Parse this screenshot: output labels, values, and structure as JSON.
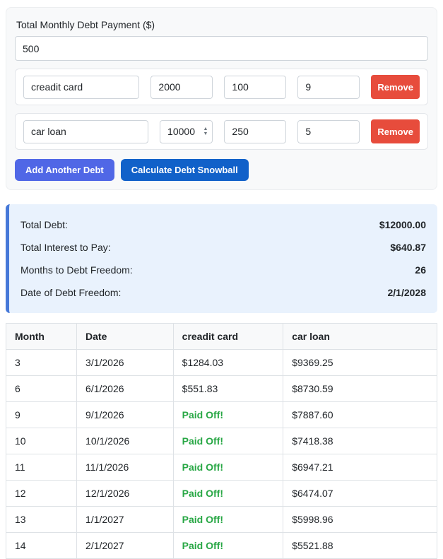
{
  "form": {
    "monthly_payment_label": "Total Monthly Debt Payment ($)",
    "monthly_payment_value": "500",
    "remove_label": "Remove",
    "debts": [
      {
        "name": "creadit card",
        "balance": "2000",
        "min_payment": "100",
        "rate": "9"
      },
      {
        "name": "car loan",
        "balance": "10000",
        "min_payment": "250",
        "rate": "5"
      }
    ],
    "add_debt_label": "Add Another Debt",
    "calculate_label": "Calculate Debt Snowball"
  },
  "summary": {
    "rows": [
      {
        "label": "Total Debt:",
        "value": "$12000.00"
      },
      {
        "label": "Total Interest to Pay:",
        "value": "$640.87"
      },
      {
        "label": "Months to Debt Freedom:",
        "value": "26"
      },
      {
        "label": "Date of Debt Freedom:",
        "value": "2/1/2028"
      }
    ]
  },
  "table": {
    "headers": [
      "Month",
      "Date",
      "creadit card",
      "car loan"
    ],
    "paid_off_text": "Paid Off!",
    "rows": [
      [
        "3",
        "3/1/2026",
        "$1284.03",
        "$9369.25"
      ],
      [
        "6",
        "6/1/2026",
        "$551.83",
        "$8730.59"
      ],
      [
        "9",
        "9/1/2026",
        "Paid Off!",
        "$7887.60"
      ],
      [
        "10",
        "10/1/2026",
        "Paid Off!",
        "$7418.38"
      ],
      [
        "11",
        "11/1/2026",
        "Paid Off!",
        "$6947.21"
      ],
      [
        "12",
        "12/1/2026",
        "Paid Off!",
        "$6474.07"
      ],
      [
        "13",
        "1/1/2027",
        "Paid Off!",
        "$5998.96"
      ],
      [
        "14",
        "2/1/2027",
        "Paid Off!",
        "$5521.88"
      ]
    ]
  },
  "colors": {
    "remove_button": "#e74c3c",
    "add_button": "#5067e6",
    "calculate_button": "#1161c9",
    "summary_background": "#e9f2fd",
    "summary_accent": "#4678d8",
    "paid_off_green": "#28a745",
    "table_header_background": "#f8f9fa"
  }
}
